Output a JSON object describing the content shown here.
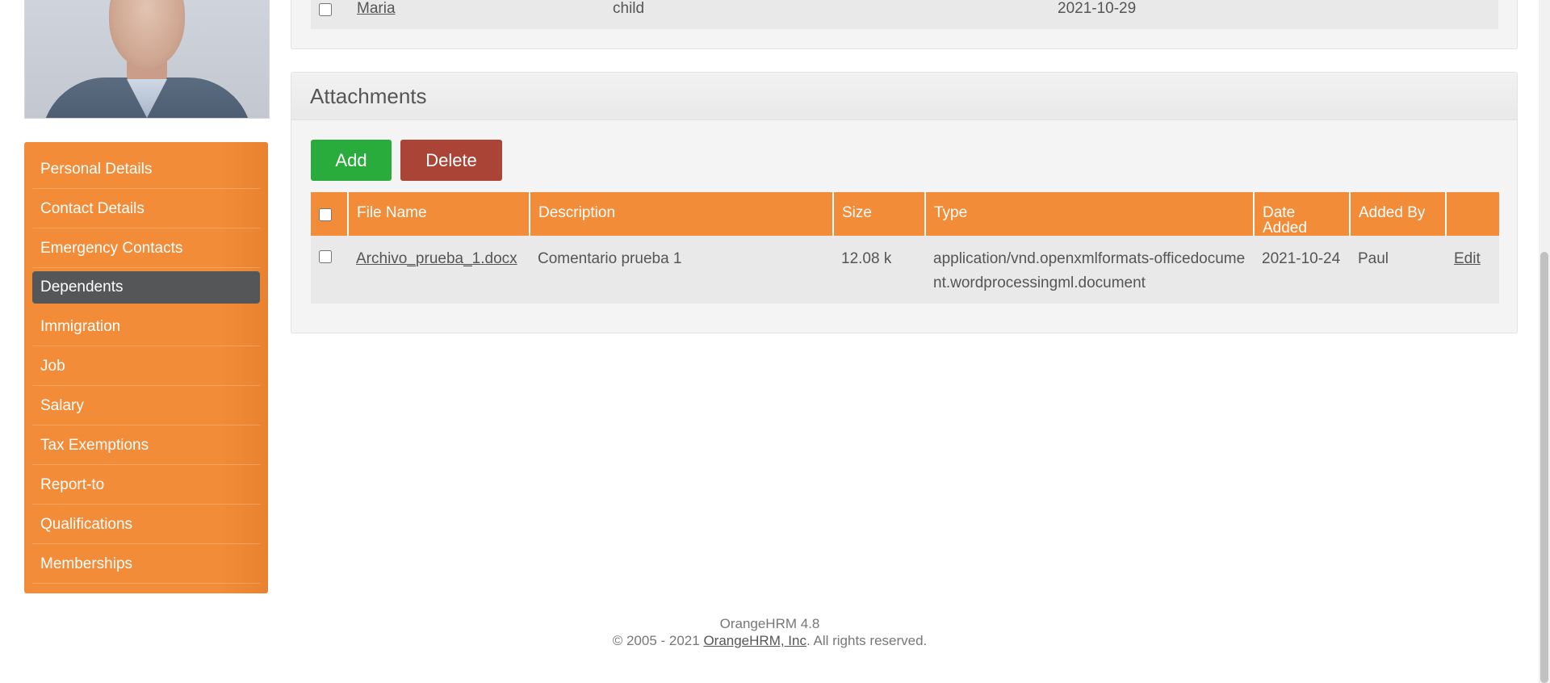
{
  "sidebar": {
    "items": [
      {
        "label": "Personal Details"
      },
      {
        "label": "Contact Details"
      },
      {
        "label": "Emergency Contacts"
      },
      {
        "label": "Dependents",
        "active": true
      },
      {
        "label": "Immigration"
      },
      {
        "label": "Job"
      },
      {
        "label": "Salary"
      },
      {
        "label": "Tax Exemptions"
      },
      {
        "label": "Report-to"
      },
      {
        "label": "Qualifications"
      },
      {
        "label": "Memberships"
      }
    ]
  },
  "dependents": {
    "row": {
      "name": "Maria",
      "relationship": "child",
      "dob": "2021-10-29"
    }
  },
  "attachments": {
    "title": "Attachments",
    "add_label": "Add",
    "delete_label": "Delete",
    "columns": [
      "File Name",
      "Description",
      "Size",
      "Type",
      "Date Added",
      "Added By"
    ],
    "rows": [
      {
        "file_name": "Archivo_prueba_1.docx",
        "description": "Comentario prueba 1",
        "size": "12.08 k",
        "type": "application/vnd.openxmlformats-officedocument.wordprocessingml.document",
        "date_added": "2021-10-24",
        "added_by": "Paul",
        "edit_label": "Edit"
      }
    ]
  },
  "footer": {
    "version": "OrangeHRM 4.8",
    "copyright_prefix": "© 2005 - 2021 ",
    "company_link": "OrangeHRM, Inc",
    "copyright_suffix": ". All rights reserved."
  },
  "colors": {
    "sidebar_bg": "#f28c38",
    "sidebar_active": "#555658",
    "add_button": "#2aac3c",
    "delete_button": "#a94436",
    "table_header": "#f28c38"
  }
}
